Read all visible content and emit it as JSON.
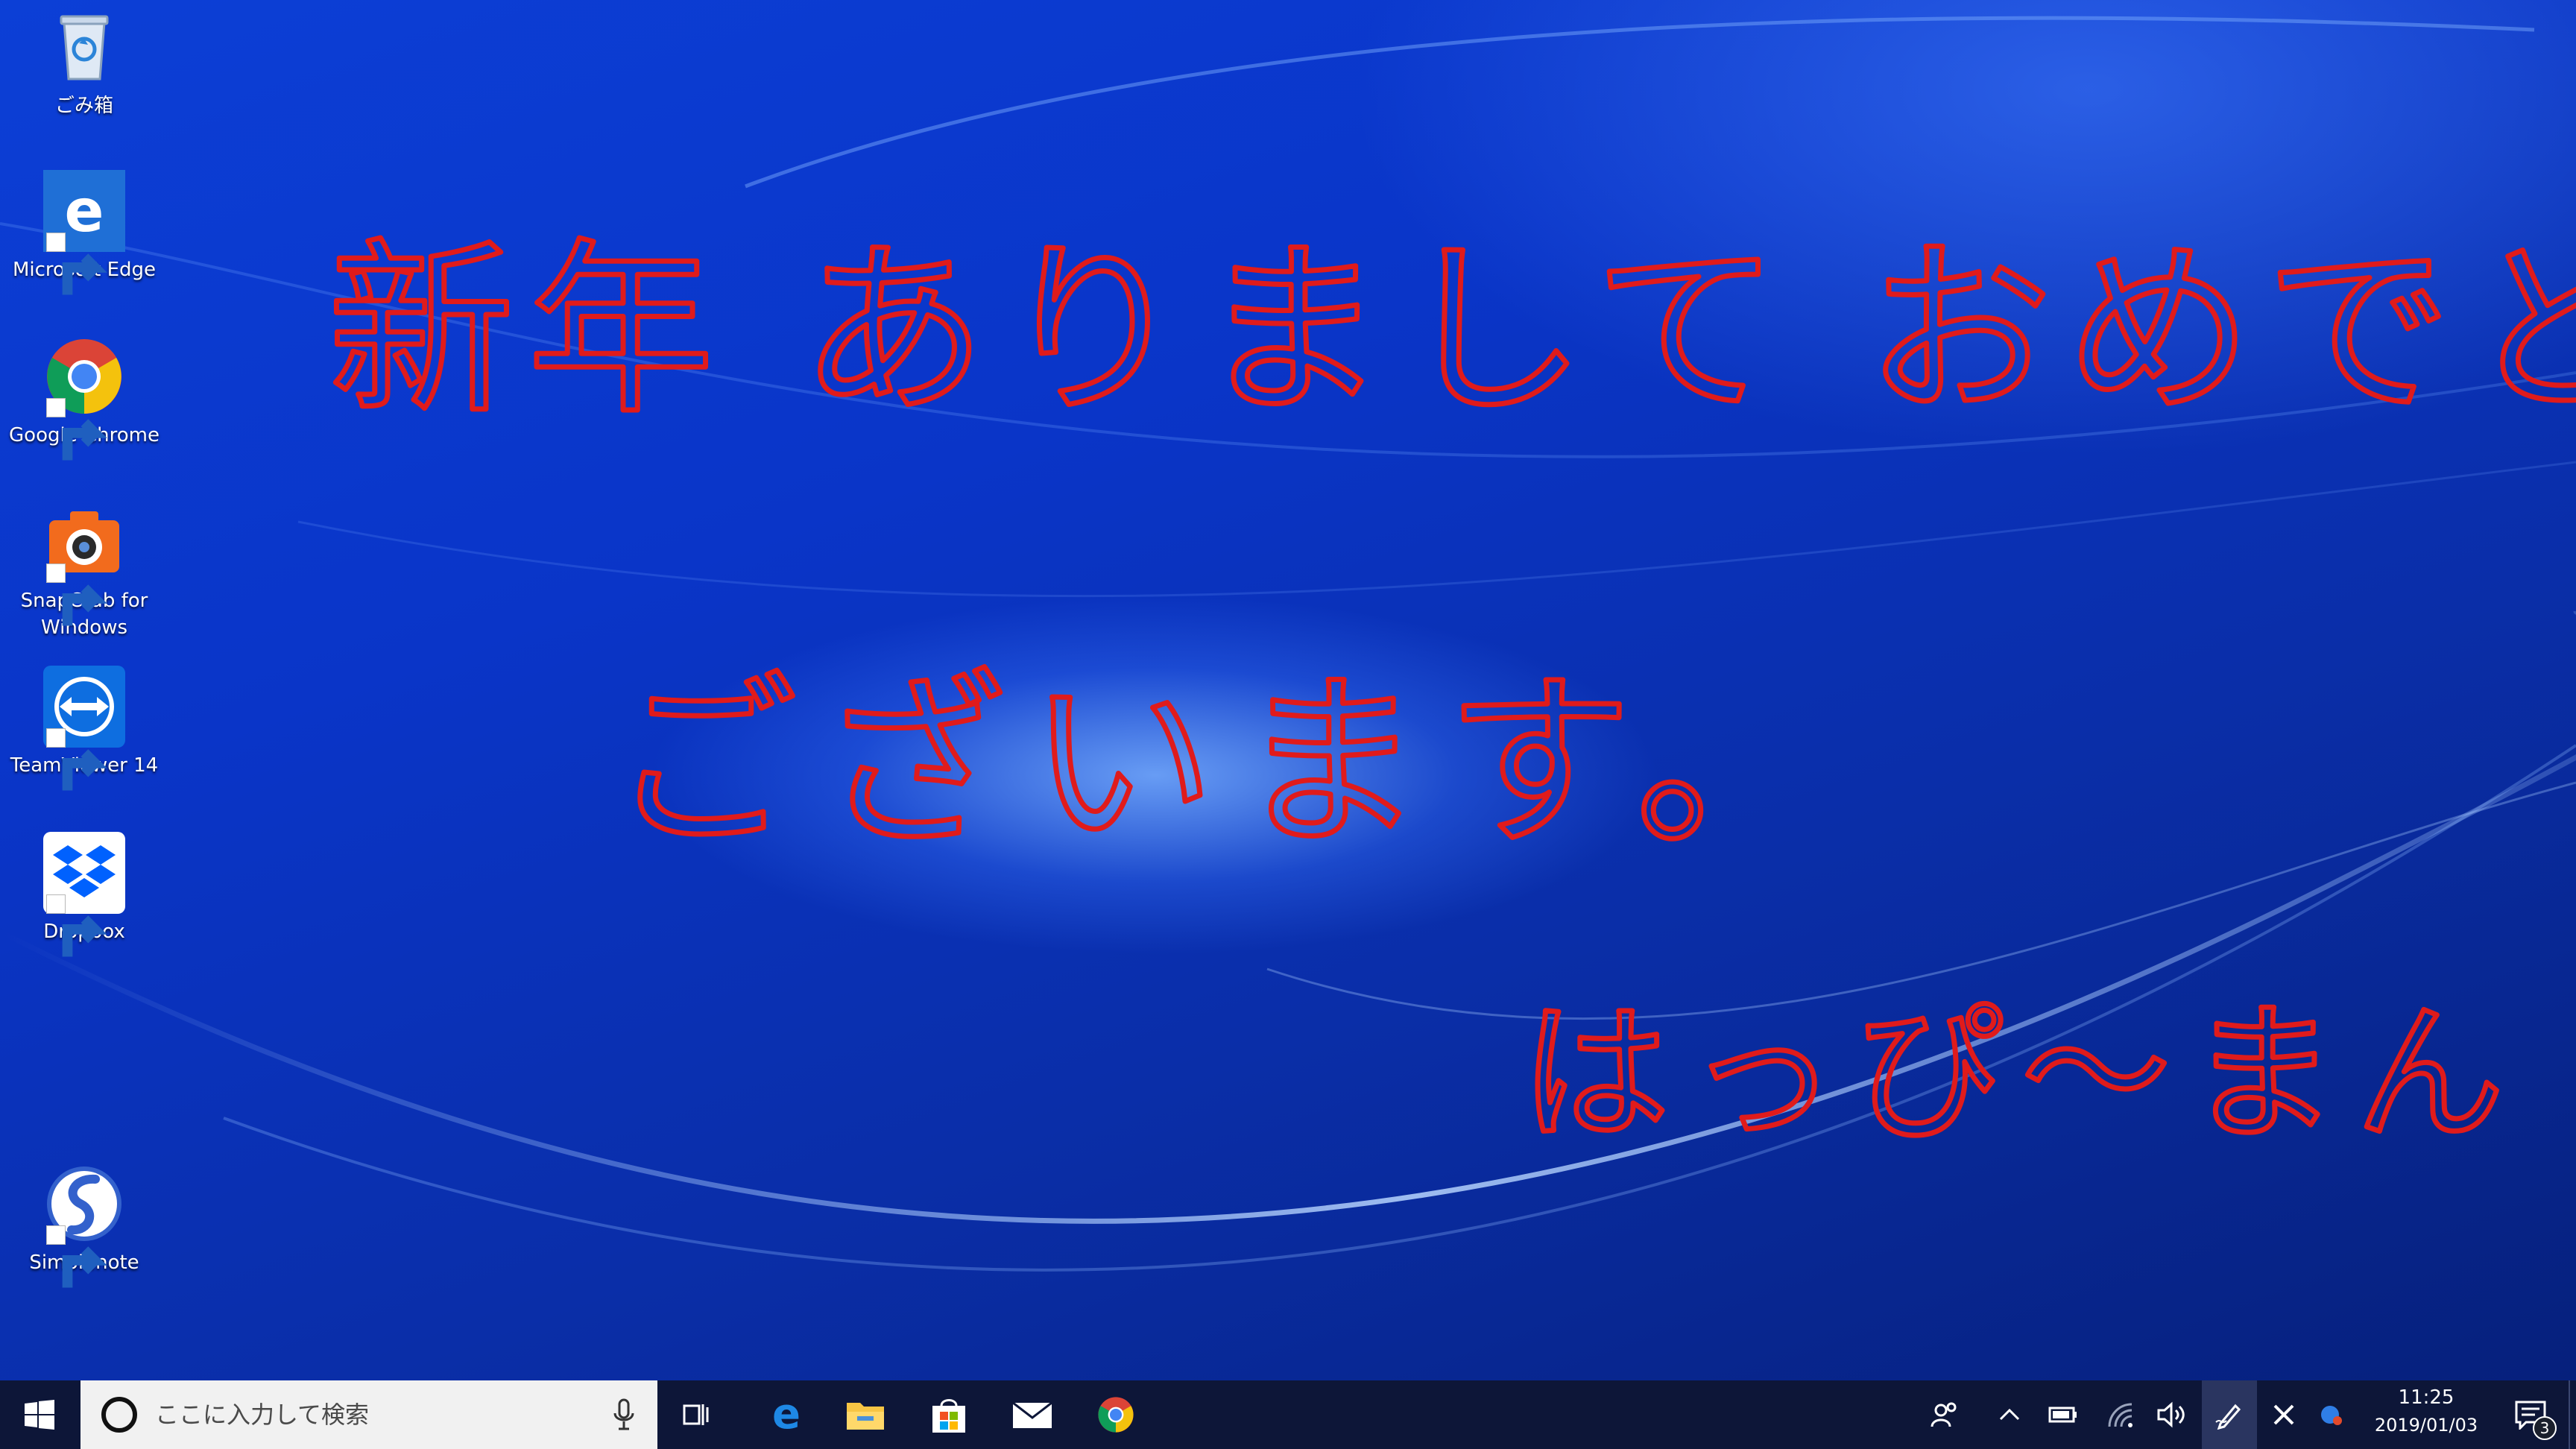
{
  "desktop": {
    "icons": [
      {
        "label": "ごみ箱",
        "icon": "recycle-bin-icon"
      },
      {
        "label": "Microsoft Edge",
        "icon": "edge-icon"
      },
      {
        "label": "Google Chrome",
        "icon": "chrome-icon"
      },
      {
        "label": "SnapCrab for Windows",
        "icon": "camera-icon"
      },
      {
        "label": "TeamViewer 14",
        "icon": "teamviewer-icon"
      },
      {
        "label": "Dropbox",
        "icon": "dropbox-icon"
      },
      {
        "label": "Simplenote",
        "icon": "simplenote-icon"
      }
    ],
    "handwriting": {
      "line1": "新年 ありまして おめでとう",
      "line2": "ございます。",
      "signature": "はっぴ〜まん",
      "ink_color": "#e01b1b"
    }
  },
  "taskbar": {
    "search_placeholder": "ここに入力して検索",
    "pinned": [
      "task-view-icon",
      "edge-icon",
      "file-explorer-icon",
      "store-icon",
      "mail-icon",
      "chrome-icon"
    ],
    "clock_time": "11:25",
    "clock_date": "2019/01/03",
    "notification_count": "3",
    "accent": "#0d1638"
  }
}
